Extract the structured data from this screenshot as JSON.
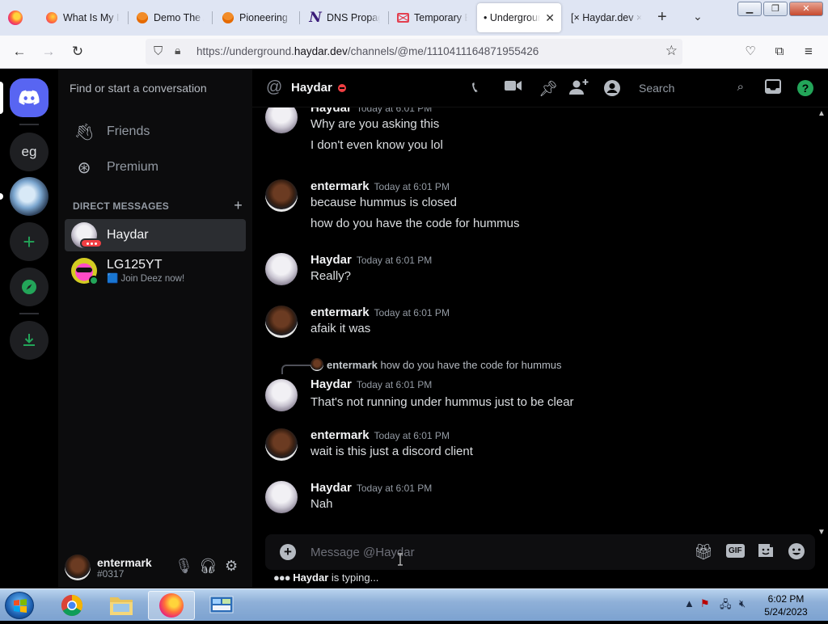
{
  "browser": {
    "tabs": [
      {
        "title": "What Is My IP Ad",
        "icon": "firefox-icon"
      },
      {
        "title": "Demo The App",
        "icon": "orange-circle-icon"
      },
      {
        "title": "Pioneering the",
        "icon": "orange-circle-icon"
      },
      {
        "title": "DNS Propagation",
        "icon": "n-logo-icon"
      },
      {
        "title": "Temporary E",
        "icon": "mail-icon"
      },
      {
        "title": "• Underground",
        "icon": "",
        "active": true
      },
      {
        "title": "[× Haydar.dev ×",
        "icon": ""
      }
    ],
    "url_prefix": "https://underground.",
    "url_domain": "haydar.dev",
    "url_path": "/channels/@me/1110411164871955426"
  },
  "discord": {
    "servers": [
      {
        "label": "eg"
      },
      {
        "label": "+"
      }
    ],
    "dm_search_placeholder": "Find or start a conversation",
    "nav": [
      {
        "label": "Friends",
        "icon": "friends-wave-icon"
      },
      {
        "label": "Premium",
        "icon": "nitro-icon"
      }
    ],
    "dm_header": "DIRECT MESSAGES",
    "dms": [
      {
        "name": "Haydar",
        "status": "dnd",
        "active": true
      },
      {
        "name": "LG125YT",
        "status": "online",
        "activity": "🟦 Join Deez now!"
      }
    ],
    "user": {
      "name": "entermark",
      "tag": "#0317"
    },
    "chat": {
      "title": "Haydar",
      "search_placeholder": "Search",
      "composer_placeholder": "Message @Haydar",
      "typing_user": "Haydar",
      "typing_suffix": "is typing..."
    },
    "messages": [
      {
        "author": "Haydar",
        "time": "Today at 6:01 PM",
        "lines": [
          "Why are you asking this",
          "I don't even know you lol"
        ]
      },
      {
        "author": "entermark",
        "time": "Today at 6:01 PM",
        "lines": [
          "because hummus is closed",
          "how do you have the code for hummus"
        ]
      },
      {
        "author": "Haydar",
        "time": "Today at 6:01 PM",
        "lines": [
          "Really?"
        ]
      },
      {
        "author": "entermark",
        "time": "Today at 6:01 PM",
        "lines": [
          "afaik it was"
        ]
      },
      {
        "author": "Haydar",
        "time": "Today at 6:01 PM",
        "lines": [
          "That's not running under hummus just to be clear"
        ],
        "reply": {
          "author": "entermark",
          "text": "how do you have the code for hummus"
        }
      },
      {
        "author": "entermark",
        "time": "Today at 6:01 PM",
        "lines": [
          "wait is this just a discord client"
        ]
      },
      {
        "author": "Haydar",
        "time": "Today at 6:01 PM",
        "lines": [
          "Nah"
        ]
      }
    ],
    "colors": {
      "blurple": "#5865f2",
      "green": "#23a559",
      "dnd": "#f23f43"
    }
  },
  "taskbar": {
    "time": "6:02 PM",
    "date": "5/24/2023"
  }
}
